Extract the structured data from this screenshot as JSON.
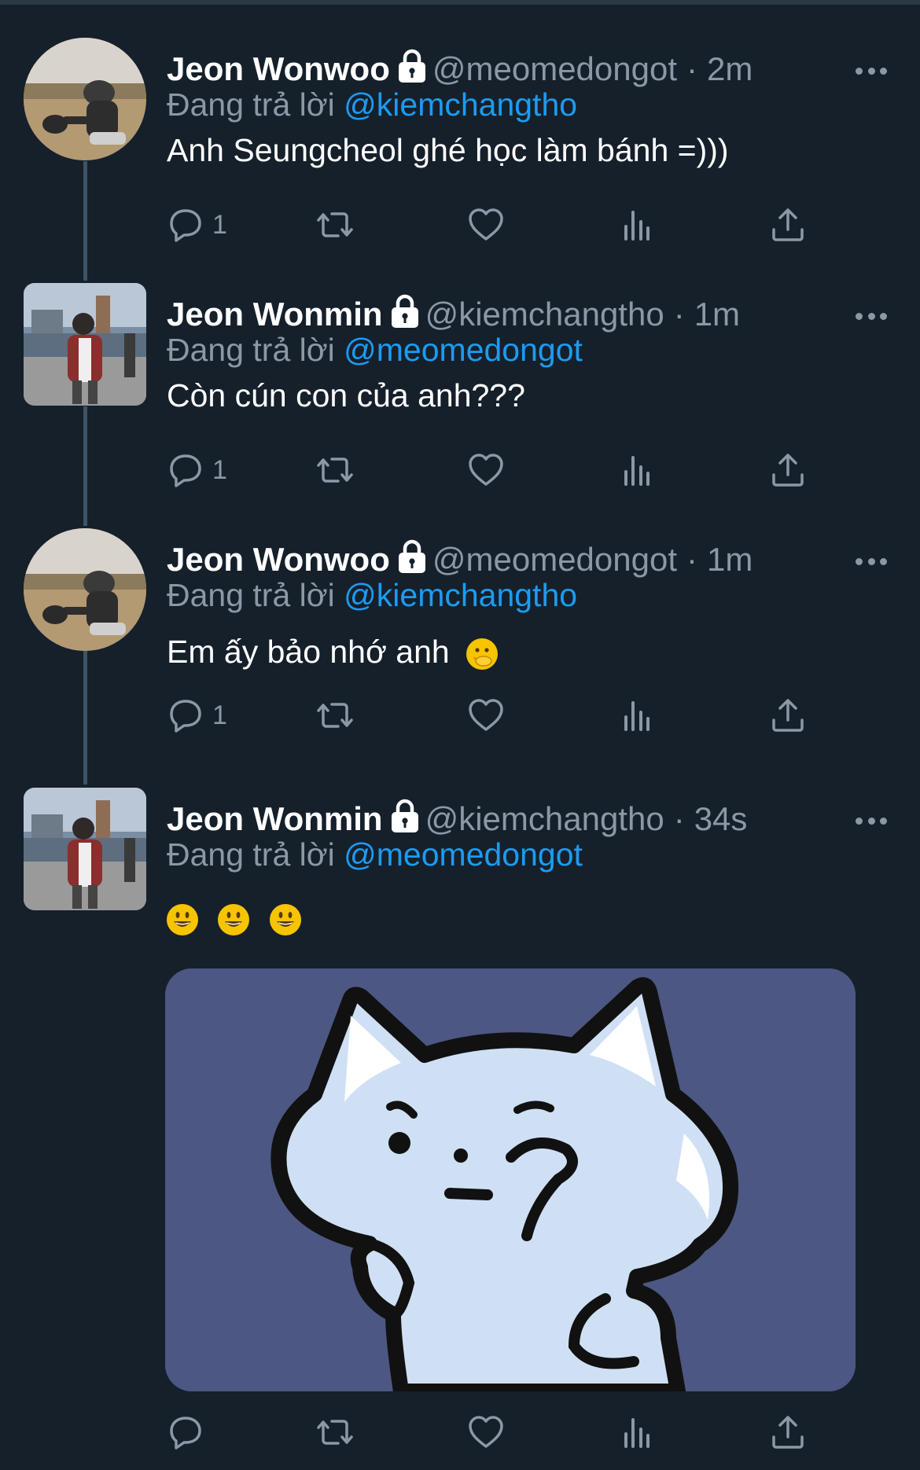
{
  "tweets": [
    {
      "name": "Jeon Wonwoo",
      "handle": "@meomedongot",
      "time": "2m",
      "reply_prefix": "Đang trả lời",
      "reply_to": "@kiemchangtho",
      "text": "Anh Seungcheol ghé học làm bánh =)))",
      "reply_count": "1"
    },
    {
      "name": "Jeon Wonmin",
      "handle": "@kiemchangtho",
      "time": "1m",
      "reply_prefix": "Đang trả lời",
      "reply_to": "@meomedongot",
      "text": "Còn cún con của anh???",
      "reply_count": "1"
    },
    {
      "name": "Jeon Wonwoo",
      "handle": "@meomedongot",
      "time": "1m",
      "reply_prefix": "Đang trả lời",
      "reply_to": "@kiemchangtho",
      "text": "Em ấy bảo nhớ anh",
      "reply_count": "1"
    },
    {
      "name": "Jeon Wonmin",
      "handle": "@kiemchangtho",
      "time": "34s",
      "reply_prefix": "Đang trả lời",
      "reply_to": "@meomedongot",
      "text": "",
      "reply_count": ""
    }
  ],
  "icons": {
    "separator": "·",
    "lock": "lock-icon",
    "more": "more-icon",
    "reply": "reply-icon",
    "retweet": "retweet-icon",
    "like": "heart-icon",
    "views": "views-icon",
    "share": "share-icon"
  },
  "colors": {
    "background": "#15202b",
    "text": "#ffffff",
    "secondary": "#8b98a5",
    "mention": "#1d9bf0",
    "thread": "#3d5466",
    "media_bg": "#4c5783"
  }
}
